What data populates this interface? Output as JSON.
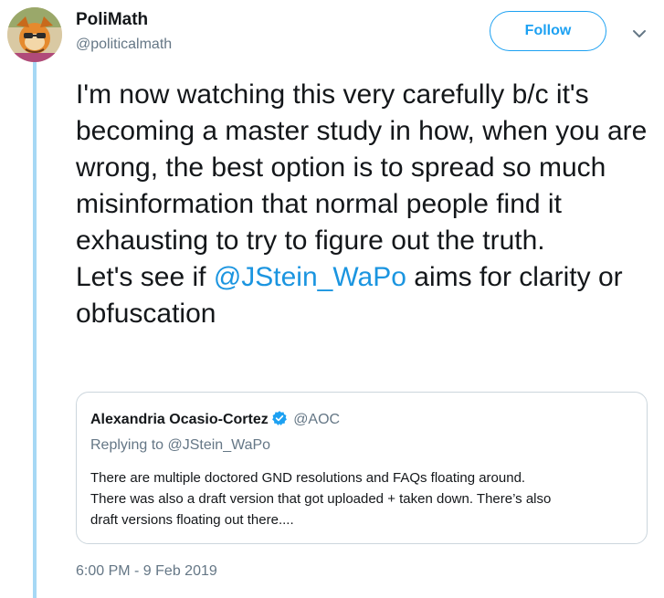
{
  "author": {
    "name": "PoliMath",
    "handle": "@politicalmath"
  },
  "follow_button": {
    "label": "Follow"
  },
  "menu": {
    "icon": "chevron-down-icon"
  },
  "tweet": {
    "text_before": "I'm now watching this very carefully b/c it's becoming a master study in how, when you are wrong, the best option is to spread so much misinformation that normal people find it exhausting to try to figure out the truth.\nLet's see if ",
    "mention": "@JStein_WaPo",
    "text_after": " aims for clarity or obfuscation",
    "timestamp": "6:00 PM - 9 Feb 2019"
  },
  "quoted_tweet": {
    "name": "Alexandria Ocasio-Cortez",
    "verified_icon": "verified-badge-icon",
    "handle": "@AOC",
    "replying_to": "Replying to @JStein_WaPo",
    "text": "There are multiple doctored GND resolutions and FAQs floating around.\nThere was also a draft version that got uploaded + taken down. There’s also\ndraft versions floating out there...."
  },
  "colors": {
    "link": "#1b95e0",
    "follow_border": "#1da1f2",
    "thread_line": "#a6d8f5",
    "muted_text": "#657786"
  }
}
